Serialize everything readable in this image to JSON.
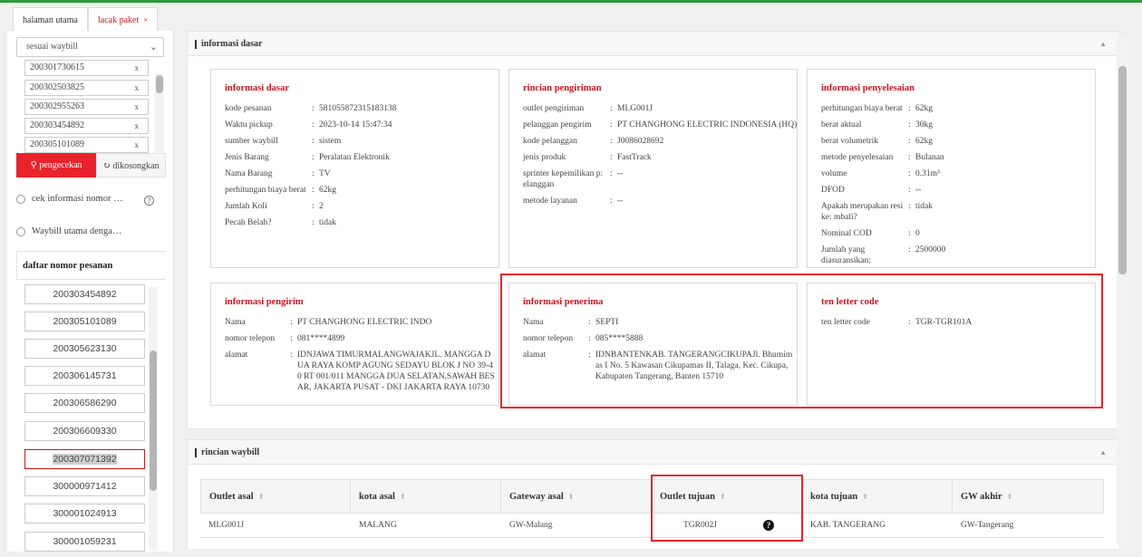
{
  "tabs": [
    {
      "label": "halaman utama"
    },
    {
      "label": "lacak paket",
      "close": "×"
    }
  ],
  "sidebar": {
    "select_value": "sesuai waybill",
    "waybill_inputs": [
      "200301730615",
      "200302503825",
      "200302955263",
      "200303454892",
      "200305101089"
    ],
    "remove_glyph": "x",
    "check_button": "pengecekan",
    "clear_button": "dikosongkan",
    "radio_1": "cek informasi nomor …",
    "radio_2": "Waybill utama denga…",
    "list_title": "daftar nomor pesanan",
    "orders": [
      "200303454892",
      "200305101089",
      "200305623130",
      "200306145731",
      "200306586290",
      "200306609330",
      "200307071392",
      "300000971412",
      "300001024913",
      "300001059231"
    ],
    "selected_order": "200307071392"
  },
  "basic_info": {
    "section_title": "informasi dasar",
    "cards": {
      "dasar": {
        "title": "informasi dasar",
        "rows": [
          {
            "k": "kode pesanan",
            "v": "581055872315183138"
          },
          {
            "k": "Waktu pickup",
            "v": "2023-10-14 15:47:34"
          },
          {
            "k": "sumber waybill",
            "v": "sistem"
          },
          {
            "k": "Jenis Barang",
            "v": "Peralatan Elektronik"
          },
          {
            "k": "Nama Barang",
            "v": "TV"
          },
          {
            "k": "perhitungan biaya berat",
            "v": "62kg"
          },
          {
            "k": "Jumlah Koli",
            "v": "2"
          },
          {
            "k": "Pecah Belah?",
            "v": "tidak"
          }
        ]
      },
      "pengiriman": {
        "title": "rincian pengiriman",
        "rows": [
          {
            "k": "outlet pengiriman",
            "v": "MLG001J"
          },
          {
            "k": "pelanggan pengirim",
            "v": "PT CHANGHONG ELECTRIC INDONESIA (HQ)"
          },
          {
            "k": "kode pelanggan",
            "v": "J0086028692"
          },
          {
            "k": "jenis produk",
            "v": "FastTrack"
          },
          {
            "k": "sprinter kepemilikan p: elanggan",
            "v": "--"
          },
          {
            "k": "metode layanan",
            "v": "--"
          }
        ]
      },
      "penyelesaian": {
        "title": "informasi penyelesaian",
        "rows": [
          {
            "k": "perhitungan biaya berat",
            "v": "62kg"
          },
          {
            "k": "berat aktual",
            "v": "30kg"
          },
          {
            "k": "berat volumetrik",
            "v": "62kg"
          },
          {
            "k": "metode penyelesaian",
            "v": "Bulanan"
          },
          {
            "k": "volume",
            "v": "0.31m³"
          },
          {
            "k": "DFOD",
            "v": "--"
          },
          {
            "k": "Apakah merupakan resi ke: mbali?",
            "v": "tidak"
          },
          {
            "k": "Nominal COD",
            "v": "0"
          },
          {
            "k": "Jumlah yang diasuransikan:",
            "v": "2500000"
          }
        ]
      },
      "pengirim": {
        "title": "informasi pengirim",
        "rows": [
          {
            "k": "Nama",
            "v": "PT CHANGHONG ELECTRIC INDO"
          },
          {
            "k": "nomor telepon",
            "v": "081****4899"
          },
          {
            "k": "alamat",
            "v": "IDNJAWA TIMURMALANGWAJAKJL. MANGGA D UA RAYA KOMP AGUNG SEDAYU BLOK J NO 39-4 0 RT 001/011 MANGGA DUA SELATAN,SAWAH BES AR, JAKARTA PUSAT - DKI JAKARTA RAYA 10730"
          }
        ]
      },
      "penerima": {
        "title": "informasi penerima",
        "rows": [
          {
            "k": "Nama",
            "v": "SEPTI"
          },
          {
            "k": "nomor telepon",
            "v": "085****5888"
          },
          {
            "k": "alamat",
            "v": "IDNBANTENKAB. TANGERANGCIKUPAJl. Bhumim as I No. 5 Kawasan Cikupamas II, Talaga, Kec. Cikupa, Kabupaten Tangerang, Banten 15710"
          }
        ]
      },
      "tenletter": {
        "title": "ten letter code",
        "rows": [
          {
            "k": "ten letter code",
            "v": "TGR-TGR101A"
          }
        ]
      }
    }
  },
  "waybill_detail": {
    "section_title": "rincian waybill",
    "headers": [
      "Outlet asal",
      "kota asal",
      "Gateway asal",
      "Outlet tujuan",
      "kota tujuan",
      "GW akhir"
    ],
    "row": [
      "MLG001J",
      "MALANG",
      "GW-Malang",
      "TGR002J",
      "KAB. TANGERANG",
      "GW-Tangerang"
    ],
    "help_glyph": "?"
  },
  "icons": {
    "chevron": "chevron-down-icon",
    "search": "search-icon",
    "clear": "refresh-icon",
    "collapse": "caret-up-icon",
    "sort": "sort-icon"
  },
  "colors": {
    "accent_red": "#e8232b",
    "title_red": "#c8161d",
    "top_line_green": "#2c9a3a"
  }
}
